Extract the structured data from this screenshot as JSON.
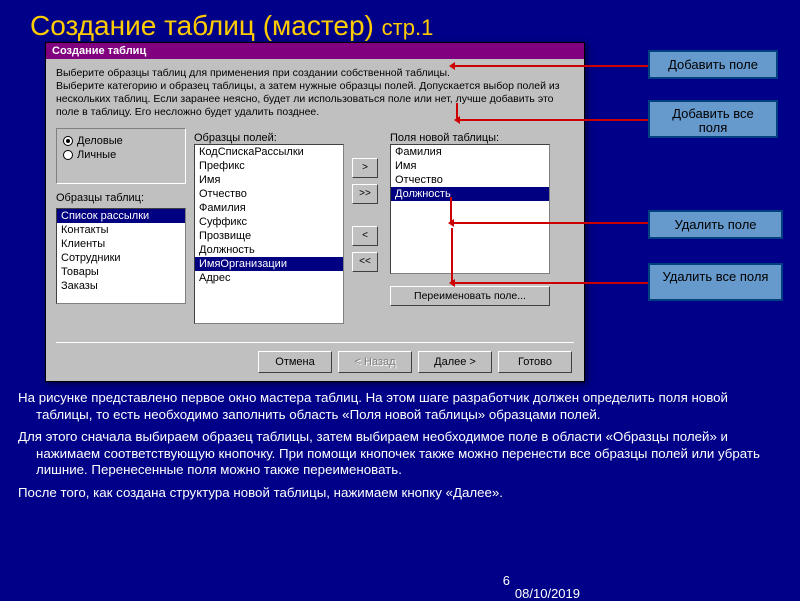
{
  "slide": {
    "title_main": "Создание таблиц (мастер)",
    "title_sub": "стр.1",
    "page_number": "6",
    "date": "08/10/2019"
  },
  "dialog": {
    "title": "Создание таблиц",
    "intro": "Выберите образцы таблиц для применения при создании собственной таблицы.\nВыберите категорию и образец таблицы, а затем нужные образцы полей. Допускается выбор полей из нескольких таблиц. Если заранее неясно, будет ли использоваться поле или нет, лучше добавить это поле в таблицу. Его несложно будет удалить позднее.",
    "radio1": "Деловые",
    "radio2": "Личные",
    "tables_label": "Образцы таблиц:",
    "tables": [
      "Список рассылки",
      "Контакты",
      "Клиенты",
      "Сотрудники",
      "Товары",
      "Заказы"
    ],
    "tables_selected_index": 0,
    "fields_label": "Образцы полей:",
    "fields": [
      "КодСпискаРассылки",
      "Префикс",
      "Имя",
      "Отчество",
      "Фамилия",
      "Суффикс",
      "Прозвище",
      "Должность",
      "ИмяОрганизации",
      "Адрес"
    ],
    "fields_selected_index": 8,
    "newfields_label": "Поля новой таблицы:",
    "newfields": [
      "Фамилия",
      "Имя",
      "Отчество",
      "Должность"
    ],
    "newfields_selected_index": 3,
    "btn_add": ">",
    "btn_add_all": ">>",
    "btn_remove": "<",
    "btn_remove_all": "<<",
    "btn_rename": "Переименовать поле...",
    "btn_cancel": "Отмена",
    "btn_back": "< Назад",
    "btn_next": "Далее >",
    "btn_finish": "Готово"
  },
  "callouts": {
    "c1": "Добавить поле",
    "c2": "Добавить все поля",
    "c3": "Удалить поле",
    "c4": "Удалить все поля"
  },
  "paragraphs": {
    "p1": "На рисунке представлено первое окно мастера таблиц. На этом шаге разработчик должен определить поля новой таблицы, то есть необходимо заполнить область «Поля новой таблицы» образцами полей.",
    "p2": "Для этого сначала выбираем образец таблицы, затем выбираем необходимое поле в области «Образцы полей» и нажимаем соответствующую кнопочку. При помощи кнопочек также можно перенести все образцы полей или убрать лишние. Перенесенные поля можно также переименовать.",
    "p3": "После того, как создана структура новой таблицы, нажимаем кнопку «Далее»."
  }
}
